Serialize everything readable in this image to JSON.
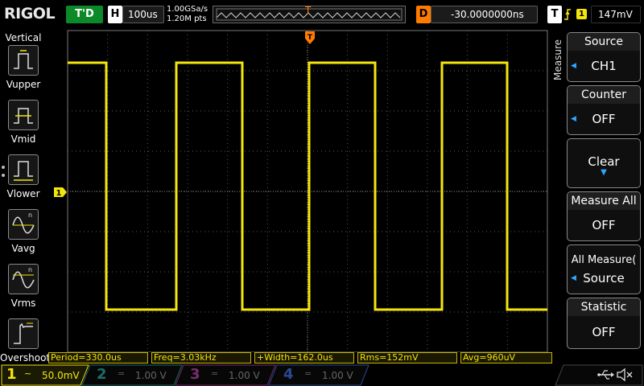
{
  "brand": "RIGOL",
  "trigger_status": "T'D",
  "horizontal": {
    "letter": "H",
    "scale": "100us"
  },
  "sampling": {
    "rate": "1.00GSa/s",
    "points": "1.20M pts"
  },
  "delay": {
    "letter": "D",
    "value": "-30.0000000ns"
  },
  "trigger": {
    "letter": "T",
    "channel": "1",
    "level": "147mV",
    "marker": "T"
  },
  "left_panel": {
    "title": "Vertical",
    "items": [
      {
        "label": "Vupper",
        "icon": "vupper-icon"
      },
      {
        "label": "Vmid",
        "icon": "vmid-icon"
      },
      {
        "label": "Vlower",
        "icon": "vlower-icon"
      },
      {
        "label": "Vavg",
        "icon": "vavg-icon"
      },
      {
        "label": "Vrms",
        "icon": "vrms-icon"
      },
      {
        "label": "Overshoot",
        "icon": "overshoot-icon"
      }
    ]
  },
  "ground_marker": "1",
  "right_menu": {
    "title": "Measure",
    "items": [
      {
        "title": "Source",
        "value": "CH1"
      },
      {
        "title": "Counter",
        "value": "OFF"
      },
      {
        "title": "Clear",
        "value": ""
      },
      {
        "title": "Measure All",
        "value": "OFF"
      },
      {
        "title": "All Measure(",
        "value": "Source"
      },
      {
        "title": "Statistic",
        "value": "OFF"
      }
    ]
  },
  "measurements": [
    {
      "text": "Period=330.0us"
    },
    {
      "text": "Freq=3.03kHz"
    },
    {
      "text": "+Width=162.0us"
    },
    {
      "text": "Rms=152mV"
    },
    {
      "text": "Avg=960uV"
    }
  ],
  "channels": [
    {
      "num": "1",
      "coupling": "~",
      "scale": "50.0mV",
      "active": true,
      "color": "#f4e60c"
    },
    {
      "num": "2",
      "coupling": "=",
      "scale": "1.00 V",
      "active": false,
      "color": "#1c8a88"
    },
    {
      "num": "3",
      "coupling": "=",
      "scale": "1.00 V",
      "active": false,
      "color": "#a03a8e"
    },
    {
      "num": "4",
      "coupling": "=",
      "scale": "1.00 V",
      "active": false,
      "color": "#2a55b8"
    }
  ],
  "colors": {
    "ch1": "#f4e60c",
    "trigger": "#ff7a00",
    "run_status": "#0c8a2a",
    "grid": "#5a5a5a"
  }
}
